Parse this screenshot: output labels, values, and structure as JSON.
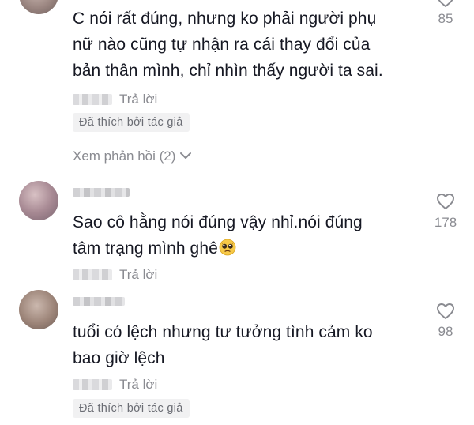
{
  "comments": [
    {
      "text_lines": [
        "C nói rất đúng, nhưng ko phải người phụ",
        "nữ nào cũng tự nhận ra cái thay đổi của",
        "bản thân mình, chỉ nhìn thấy người ta sai."
      ],
      "reply_label": "Trả lời",
      "liked_by_author_label": "Đã thích bởi tác giả",
      "likes": "85",
      "view_replies_label": "Xem phản hồi (2)"
    },
    {
      "text_lines": [
        "Sao cô hằng nói đúng vậy nhỉ.nói đúng",
        "tâm trạng mình ghê"
      ],
      "emoji": "pleading-face",
      "reply_label": "Trả lời",
      "likes": "178"
    },
    {
      "text_lines": [
        "tuổi có lệch nhưng tư tưởng tình cảm ko",
        "bao giờ lệch"
      ],
      "reply_label": "Trả lời",
      "liked_by_author_label": "Đã thích bởi tác giả",
      "likes": "98"
    }
  ],
  "icons": {
    "like": "heart-outline-icon",
    "expand": "chevron-down-icon"
  },
  "colors": {
    "text": "#161823",
    "muted": "#8a8b91",
    "badge_bg": "#f1f1f2"
  }
}
